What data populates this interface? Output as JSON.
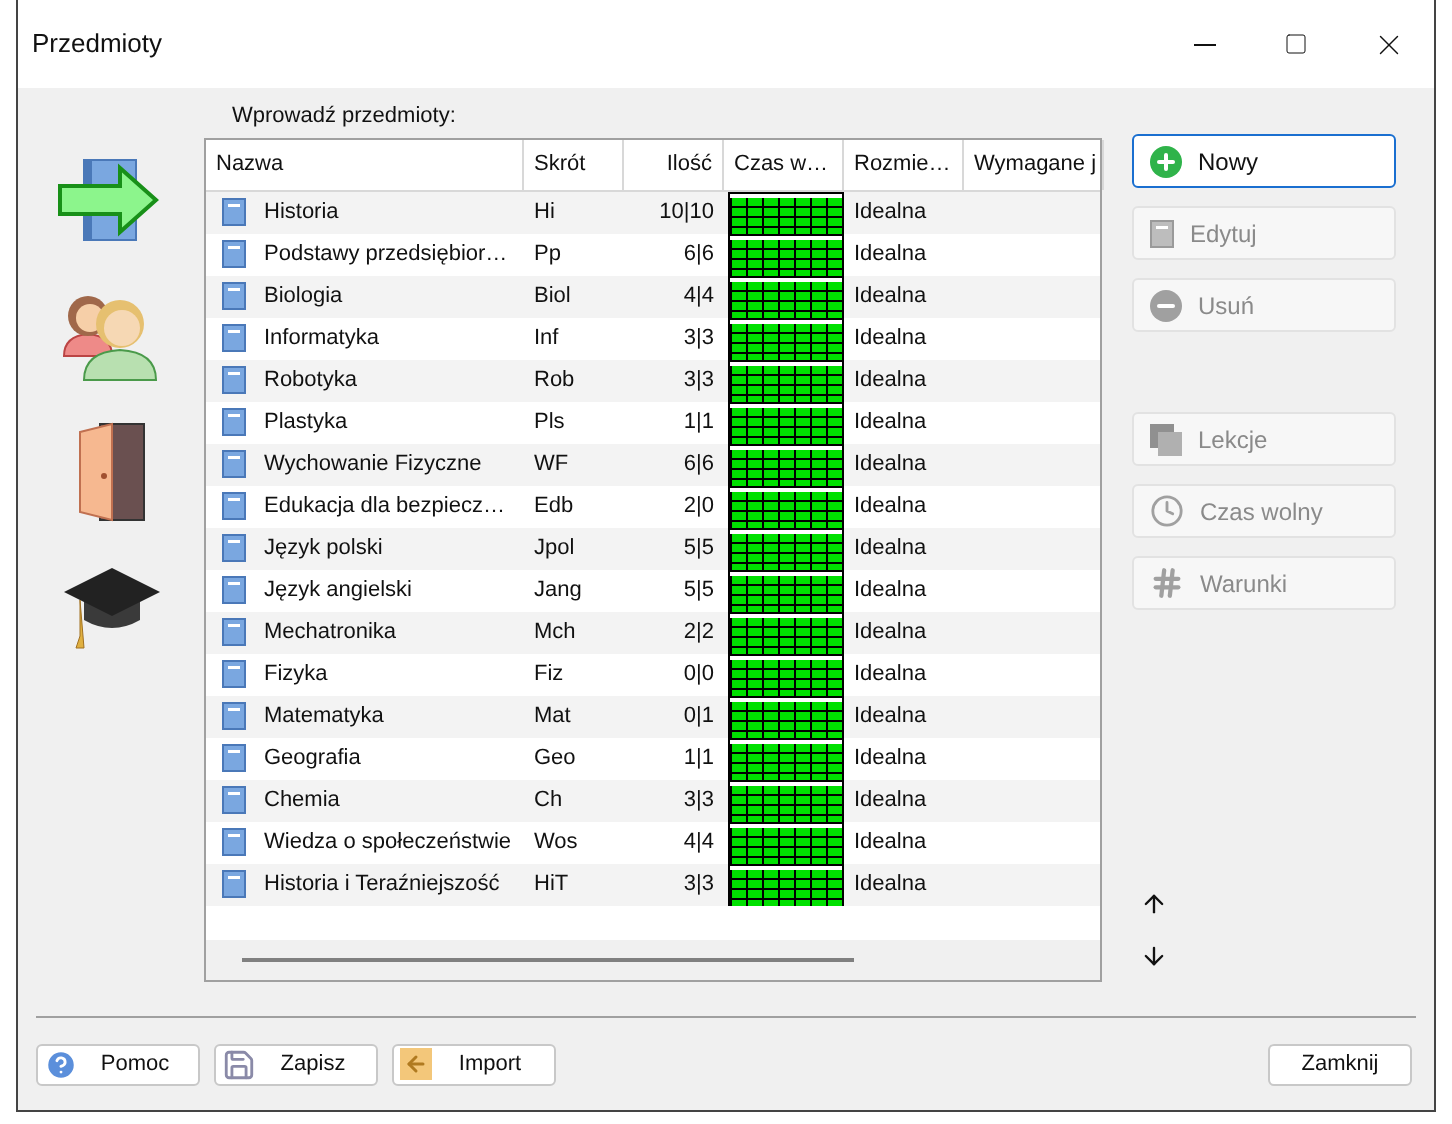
{
  "window": {
    "title": "Przedmioty"
  },
  "table_label": "Wprowadź przedmioty:",
  "table": {
    "columns": [
      "Nazwa",
      "Skrót",
      "Ilość",
      "Czas w…",
      "Rozmie…",
      "Wymagane j"
    ],
    "rows": [
      {
        "name": "Historia",
        "short": "Hi",
        "count": "10|10",
        "fit": "Idealna"
      },
      {
        "name": "Podstawy przedsiębior…",
        "short": "Pp",
        "count": "6|6",
        "fit": "Idealna"
      },
      {
        "name": "Biologia",
        "short": "Biol",
        "count": "4|4",
        "fit": "Idealna"
      },
      {
        "name": "Informatyka",
        "short": "Inf",
        "count": "3|3",
        "fit": "Idealna"
      },
      {
        "name": "Robotyka",
        "short": "Rob",
        "count": "3|3",
        "fit": "Idealna"
      },
      {
        "name": "Plastyka",
        "short": "Pls",
        "count": "1|1",
        "fit": "Idealna"
      },
      {
        "name": "Wychowanie Fizyczne",
        "short": "WF",
        "count": "6|6",
        "fit": "Idealna"
      },
      {
        "name": "Edukacja dla bezpiecz…",
        "short": "Edb",
        "count": "2|0",
        "fit": "Idealna"
      },
      {
        "name": "Język polski",
        "short": "Jpol",
        "count": "5|5",
        "fit": "Idealna"
      },
      {
        "name": "Język angielski",
        "short": "Jang",
        "count": "5|5",
        "fit": "Idealna"
      },
      {
        "name": "Mechatronika",
        "short": "Mch",
        "count": "2|2",
        "fit": "Idealna"
      },
      {
        "name": "Fizyka",
        "short": "Fiz",
        "count": "0|0",
        "fit": "Idealna"
      },
      {
        "name": "Matematyka",
        "short": "Mat",
        "count": "0|1",
        "fit": "Idealna"
      },
      {
        "name": "Geografia",
        "short": "Geo",
        "count": "1|1",
        "fit": "Idealna"
      },
      {
        "name": "Chemia",
        "short": "Ch",
        "count": "3|3",
        "fit": "Idealna"
      },
      {
        "name": "Wiedza o społeczeństwie",
        "short": "Wos",
        "count": "4|4",
        "fit": "Idealna"
      },
      {
        "name": "Historia i Teraźniejszość",
        "short": "HiT",
        "count": "3|3",
        "fit": "Idealna"
      }
    ]
  },
  "side_buttons": [
    {
      "label": "Nowy",
      "kind": "plus",
      "disabled": false
    },
    {
      "label": "Edytuj",
      "kind": "doc",
      "disabled": true
    },
    {
      "label": "Usuń",
      "kind": "minus",
      "disabled": true
    }
  ],
  "side_buttons_lower": [
    {
      "label": "Lekcje",
      "kind": "pages",
      "disabled": true
    },
    {
      "label": "Czas wolny",
      "kind": "clock",
      "disabled": true
    },
    {
      "label": "Warunki",
      "kind": "hash",
      "disabled": true
    }
  ],
  "footer_buttons": [
    {
      "label": "Pomoc",
      "kind": "help"
    },
    {
      "label": "Zapisz",
      "kind": "save"
    },
    {
      "label": "Import",
      "kind": "import"
    }
  ],
  "close_button": "Zamknij"
}
